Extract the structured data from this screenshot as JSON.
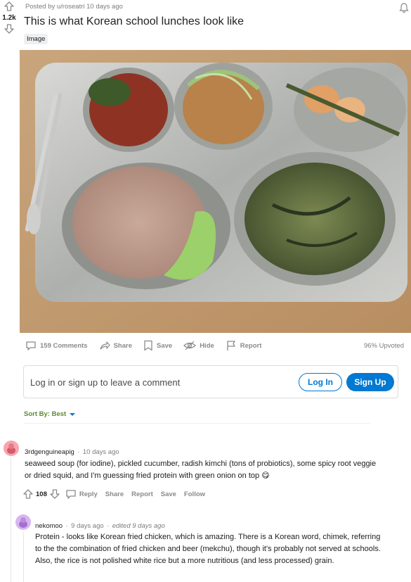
{
  "post": {
    "score": "1.2k",
    "posted_by": "Posted by u/roseatri 10 days ago",
    "title": "This is what Korean school lunches look like",
    "flair": "Image"
  },
  "actions": {
    "comments": "159 Comments",
    "share": "Share",
    "save": "Save",
    "hide": "Hide",
    "report": "Report",
    "upvoted": "96% Upvoted"
  },
  "login": {
    "prompt": "Log in or sign up to leave a comment",
    "login_label": "Log In",
    "signup_label": "Sign Up"
  },
  "sort": {
    "label": "Sort By: Best"
  },
  "comments": [
    {
      "author": "3rdgenguineapig",
      "time": "10 days ago",
      "body": "seaweed soup (for iodine), pickled cucumber, radish kimchi (tons of probiotics), some spicy root veggie or dried squid, and I'm guessing fried protein with green onion on top 😋",
      "score": "108",
      "reply": "Reply",
      "share": "Share",
      "report": "Report",
      "save": "Save",
      "follow": "Follow"
    },
    {
      "author": "nekomoo",
      "time": "9 days ago",
      "edited": "edited 9 days ago",
      "body": "Protein - looks like Korean fried chicken, which is amazing. There is a Korean word, chimek, referring to the the combination of fried chicken and beer (mekchu), though it's probably not served at schools. Also, the rice is not polished white rice but a more nutritious (and less processed) grain."
    }
  ],
  "colors": {
    "accent": "#0079d3",
    "sort_text": "#5c8a2e",
    "meta_text": "#787c7e"
  }
}
